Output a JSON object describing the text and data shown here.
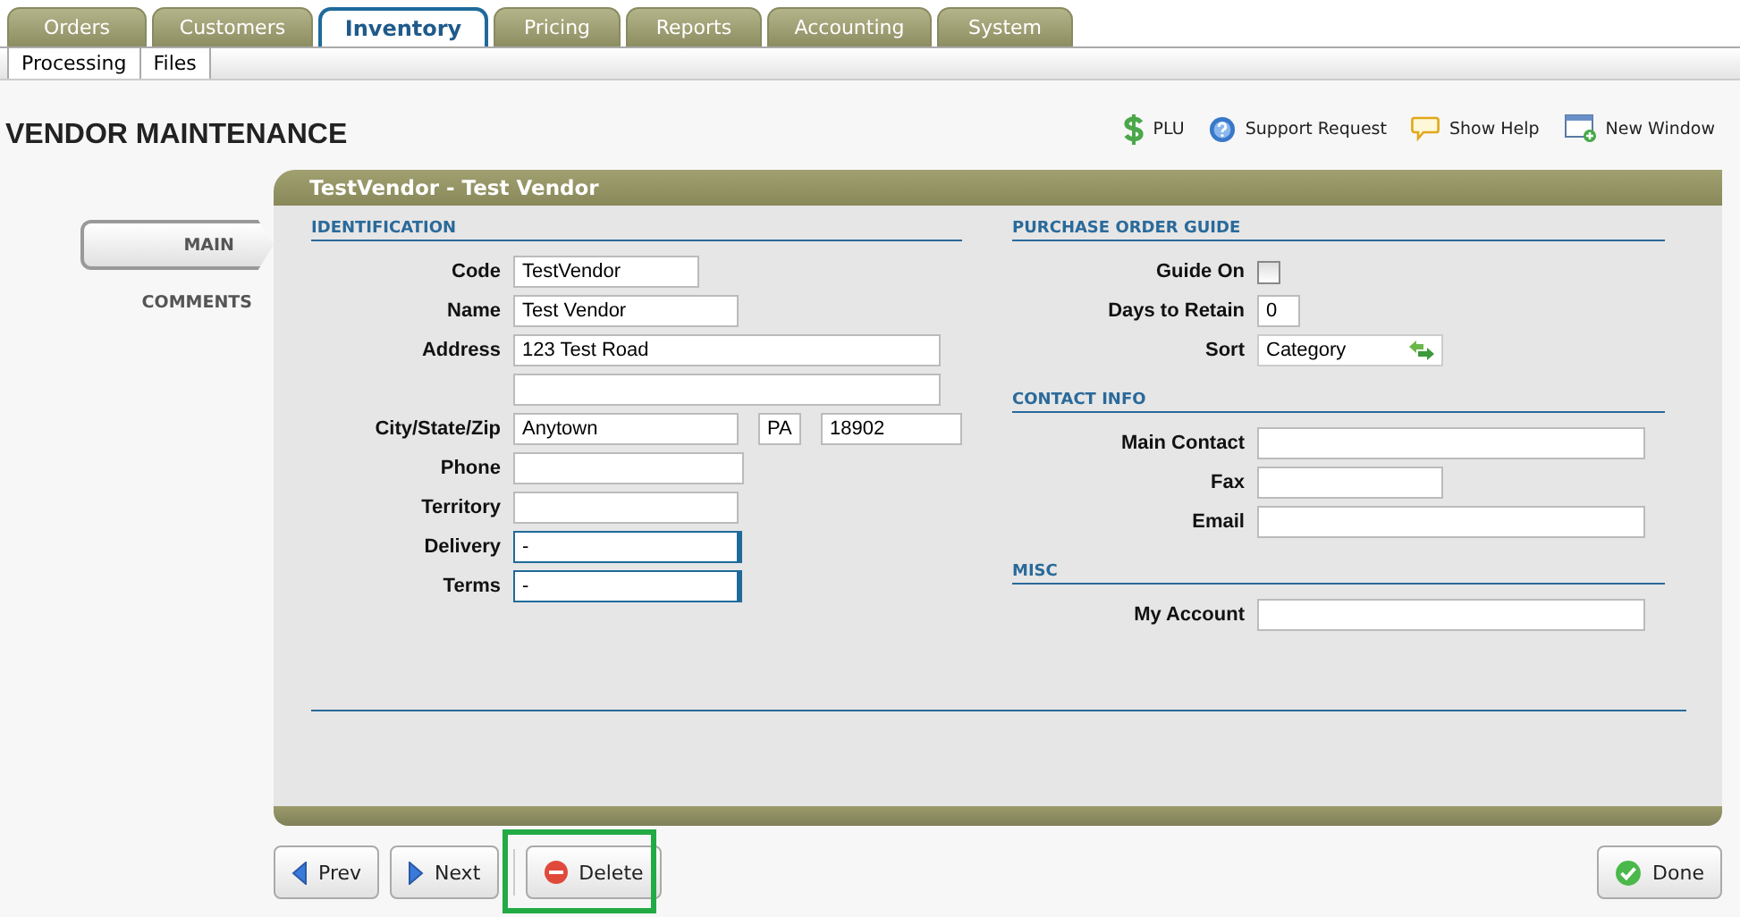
{
  "tabs": [
    {
      "label": "Orders",
      "selected": false
    },
    {
      "label": "Customers",
      "selected": false
    },
    {
      "label": "Inventory",
      "selected": true
    },
    {
      "label": "Pricing",
      "selected": false
    },
    {
      "label": "Reports",
      "selected": false
    },
    {
      "label": "Accounting",
      "selected": false
    },
    {
      "label": "System",
      "selected": false
    }
  ],
  "subtabs": [
    {
      "label": "Processing"
    },
    {
      "label": "Files"
    }
  ],
  "page_title": "VENDOR MAINTENANCE",
  "header_links": [
    {
      "kind": "dollar",
      "label": "PLU"
    },
    {
      "kind": "help",
      "label": "Support Request"
    },
    {
      "kind": "bubble",
      "label": "Show Help"
    },
    {
      "kind": "window",
      "label": "New Window"
    }
  ],
  "side_nav": [
    {
      "label": "MAIN",
      "selected": true
    },
    {
      "label": "COMMENTS",
      "selected": false
    }
  ],
  "panel_title": "TestVendor - Test Vendor",
  "columns": [
    {
      "sections": [
        {
          "title": "IDENTIFICATION",
          "rows": [
            {
              "label": "Code",
              "inputs": [
                {
                  "kind": "text",
                  "value": "TestVendor"
                }
              ]
            },
            {
              "label": "Name",
              "inputs": [
                {
                  "kind": "text",
                  "value": "Test Vendor"
                }
              ]
            },
            {
              "label": "Address",
              "inputs": [
                {
                  "kind": "text",
                  "value": "123 Test Road"
                }
              ]
            },
            {
              "inputs": [
                {
                  "kind": "text"
                }
              ]
            },
            {
              "label": "City/State/Zip",
              "inputs": [
                {
                  "kind": "text",
                  "value": "Anytown"
                },
                {
                  "kind": "text",
                  "value": "PA"
                },
                {
                  "kind": "text",
                  "value": "18902"
                }
              ]
            },
            {
              "label": "Phone",
              "inputs": [
                {
                  "kind": "text"
                }
              ]
            },
            {
              "label": "Territory",
              "inputs": [
                {
                  "kind": "text"
                }
              ]
            },
            {
              "label": "Delivery",
              "inputs": [
                {
                  "kind": "lookup",
                  "value": "-"
                }
              ]
            },
            {
              "label": "Terms",
              "inputs": [
                {
                  "kind": "lookup",
                  "value": "-"
                }
              ]
            }
          ]
        }
      ]
    },
    {
      "sections": [
        {
          "title": "PURCHASE ORDER GUIDE",
          "rows": [
            {
              "label": "Guide On",
              "inputs": [
                {
                  "kind": "checkbox",
                  "checked": false
                }
              ]
            },
            {
              "label": "Days to Retain",
              "inputs": [
                {
                  "kind": "text",
                  "value": "0"
                }
              ]
            },
            {
              "label": "Sort",
              "inputs": [
                {
                  "kind": "select",
                  "value": "Category"
                }
              ]
            }
          ]
        },
        {
          "title": "CONTACT INFO",
          "rows": [
            {
              "label": "Main Contact",
              "inputs": [
                {
                  "kind": "text"
                }
              ]
            },
            {
              "label": "Fax",
              "inputs": [
                {
                  "kind": "text"
                }
              ]
            },
            {
              "label": "Email",
              "inputs": [
                {
                  "kind": "text"
                }
              ]
            }
          ]
        },
        {
          "title": "MISC",
          "rows": [
            {
              "label": "My Account",
              "inputs": [
                {
                  "kind": "text"
                }
              ]
            }
          ]
        }
      ]
    }
  ],
  "buttons": [
    {
      "kind": "prev",
      "label": "Prev"
    },
    {
      "kind": "next",
      "label": "Next"
    },
    {
      "kind": "delete",
      "label": "Delete",
      "highlighted": true
    },
    {
      "kind": "done",
      "label": "Done"
    }
  ]
}
